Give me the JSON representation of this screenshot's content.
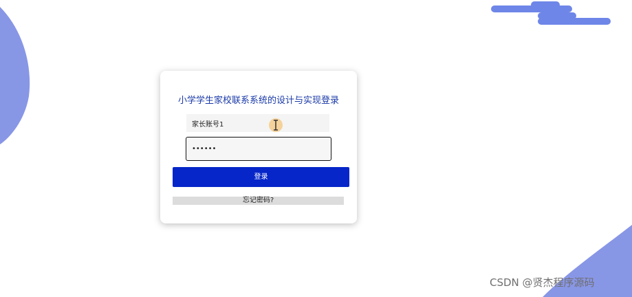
{
  "login": {
    "title": "小学学生家校联系系统的设计与实现登录",
    "username_value": "家长账号1",
    "password_value": "••••••",
    "login_label": "登录",
    "forgot_label": "忘记密码?"
  },
  "watermark": "CSDN @贤杰程序源码",
  "colors": {
    "primary": "#0626c9",
    "title": "#1838a8",
    "decoration": "#8896e6",
    "cursor_highlight": "#f5c77e"
  }
}
